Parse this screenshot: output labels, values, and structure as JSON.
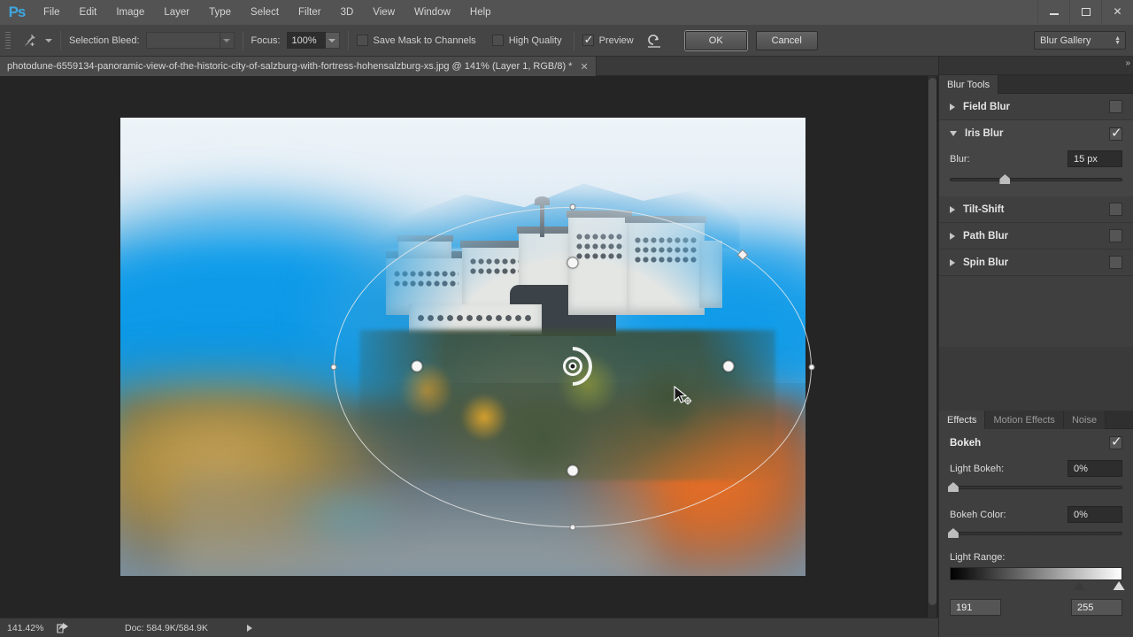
{
  "app": {
    "logo": "Ps",
    "menu": [
      "File",
      "Edit",
      "Image",
      "Layer",
      "Type",
      "Select",
      "Filter",
      "3D",
      "View",
      "Window",
      "Help"
    ],
    "window_controls": {
      "minimize": "minimize-icon",
      "maximize": "maximize-icon",
      "close": "✕"
    }
  },
  "options_bar": {
    "tool_icon": "blur-pin-tool-icon",
    "selection_bleed_label": "Selection Bleed:",
    "selection_bleed_value": "",
    "focus_label": "Focus:",
    "focus_value": "100%",
    "save_mask_label": "Save Mask to Channels",
    "save_mask_checked": false,
    "high_quality_label": "High Quality",
    "high_quality_checked": false,
    "preview_label": "Preview",
    "preview_checked": true,
    "reset_icon": "reset-arrow-icon",
    "ok_label": "OK",
    "cancel_label": "Cancel",
    "workspace_value": "Blur Gallery"
  },
  "document": {
    "tab_title": "photodune-6559134-panoramic-view-of-the-historic-city-of-salzburg-with-fortress-hohensalzburg-xs.jpg @ 141% (Layer 1, RGB/8) *",
    "close_glyph": "✕"
  },
  "status_bar": {
    "zoom": "141.42%",
    "share_icon": "share-icon",
    "doc_info": "Doc: 584.9K/584.9K"
  },
  "right_dock": {
    "collapse_glyph": "»",
    "blur_tools": {
      "tab_label": "Blur Tools",
      "items": [
        {
          "label": "Field Blur",
          "expanded": false,
          "checked": false
        },
        {
          "label": "Iris Blur",
          "expanded": true,
          "checked": true
        },
        {
          "label": "Tilt-Shift",
          "expanded": false,
          "checked": false
        },
        {
          "label": "Path Blur",
          "expanded": false,
          "checked": false
        },
        {
          "label": "Spin Blur",
          "expanded": false,
          "checked": false
        }
      ],
      "blur_label": "Blur:",
      "blur_value": "15 px",
      "blur_slider_pct": 32
    },
    "effects": {
      "tabs": [
        {
          "label": "Effects",
          "active": true
        },
        {
          "label": "Motion Effects",
          "active": false
        },
        {
          "label": "Noise",
          "active": false
        }
      ],
      "bokeh_label": "Bokeh",
      "bokeh_checked": true,
      "light_bokeh_label": "Light Bokeh:",
      "light_bokeh_value": "0%",
      "light_bokeh_pct": 2,
      "bokeh_color_label": "Bokeh Color:",
      "bokeh_color_value": "0%",
      "bokeh_color_pct": 2,
      "light_range_label": "Light Range:",
      "light_range_min": "191",
      "light_range_max": "255",
      "light_range_min_pct": 75,
      "light_range_max_pct": 98
    }
  },
  "canvas": {
    "iris_blur": {
      "pin_name": "iris-blur-center-pin",
      "blur_dial_value": 15,
      "outer_handles": [
        "top",
        "right",
        "bottom",
        "left"
      ],
      "roundness_handle": "diamond-roundness-handle",
      "feather_handles": [
        "top",
        "right",
        "bottom",
        "left"
      ]
    },
    "cursor": "move-pin-cursor"
  },
  "colors": {
    "accent_blue": "#3ea7e0",
    "panel_bg": "#3f3f3f",
    "chrome_bg": "#535353",
    "canvas_bg": "#252525"
  }
}
